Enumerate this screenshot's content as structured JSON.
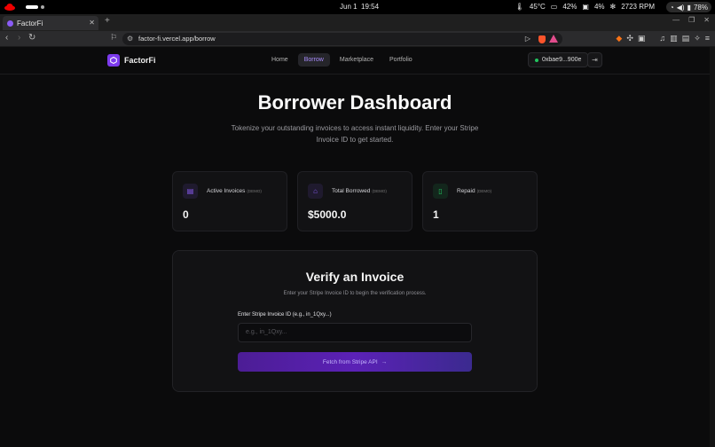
{
  "system": {
    "date": "Jun 1",
    "time": "19:54",
    "temp": "45°C",
    "cpu": "42%",
    "mem": "4%",
    "fan": "2723 RPM",
    "battery": "78%"
  },
  "browser": {
    "tab_title": "FactorFi",
    "url": "factor-fi.vercel.app/borrow"
  },
  "app": {
    "brand": "FactorFi",
    "nav": [
      {
        "label": "Home"
      },
      {
        "label": "Borrow"
      },
      {
        "label": "Marketplace"
      },
      {
        "label": "Portfolio"
      }
    ],
    "wallet": "0xbae9...900e"
  },
  "hero": {
    "title": "Borrower Dashboard",
    "subtitle": "Tokenize your outstanding invoices to access instant liquidity. Enter your Stripe Invoice ID to get started."
  },
  "stats": [
    {
      "label": "Active Invoices",
      "tag": "(DEMO)",
      "value": "0",
      "icon": "briefcase-icon",
      "color": "#8b5cf6"
    },
    {
      "label": "Total Borrowed",
      "tag": "(DEMO)",
      "value": "$5000.0",
      "icon": "bank-icon",
      "color": "#8b5cf6"
    },
    {
      "label": "Repaid",
      "tag": "(DEMO)",
      "value": "1",
      "icon": "receipt-icon",
      "color": "#22c55e"
    }
  ],
  "verify": {
    "title": "Verify an Invoice",
    "subtitle": "Enter your Stripe Invoice ID to begin the verification process.",
    "field_label": "Enter Stripe Invoice ID (e.g., in_1Qxy...)",
    "placeholder": "e.g., in_1Qxy...",
    "button": "Fetch from Stripe API"
  },
  "colors": {
    "accent": "#7c3aed",
    "background": "#0b0b0c",
    "card": "#121214"
  }
}
